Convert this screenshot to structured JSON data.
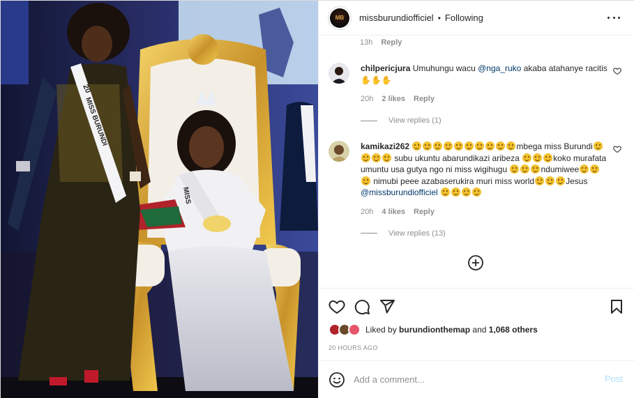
{
  "post": {
    "username": "missburundiofficiel",
    "separator": "•",
    "follow_status": "Following",
    "avatar_logo_text": "MB"
  },
  "caption_meta": {
    "time": "13h",
    "reply_label": "Reply"
  },
  "comments": [
    {
      "username": "chilpericjura",
      "text_before": "Umuhungu wacu",
      "mention": "@nga_ruko",
      "text_after": "akaba atahanye racitis",
      "time": "20h",
      "likes": "2 likes",
      "reply_label": "Reply",
      "view_replies": "View replies (1)"
    },
    {
      "username": "kamikazi262",
      "part1": "mbega miss Burundi",
      "part2": "subu ukuntu abarundikazi aribeza",
      "part3": "koko murafata umuntu usa gutya ngo ni miss wigihugu",
      "part4": "ndumiwee",
      "part5": "nimubi peee azabaserukira muri miss world",
      "part6": "Jesus",
      "mention": "@missburundiofficiel",
      "time": "20h",
      "likes": "4 likes",
      "reply_label": "Reply",
      "view_replies": "View replies (13)"
    }
  ],
  "likes_summary": {
    "prefix": "Liked by",
    "user": "burundionthemap",
    "connector": "and",
    "others": "1,068 others"
  },
  "timestamp": "20 HOURS AGO",
  "comment_box": {
    "placeholder": "Add a comment...",
    "post_label": "Post"
  },
  "photo": {
    "sash_left_text": "MISS BURUNDI",
    "sash_left_year": "20",
    "sash_right_text": "MISS"
  },
  "colors": {
    "link": "#00376b",
    "muted": "#8e8e8e",
    "post_disabled": "#b2dffc"
  }
}
